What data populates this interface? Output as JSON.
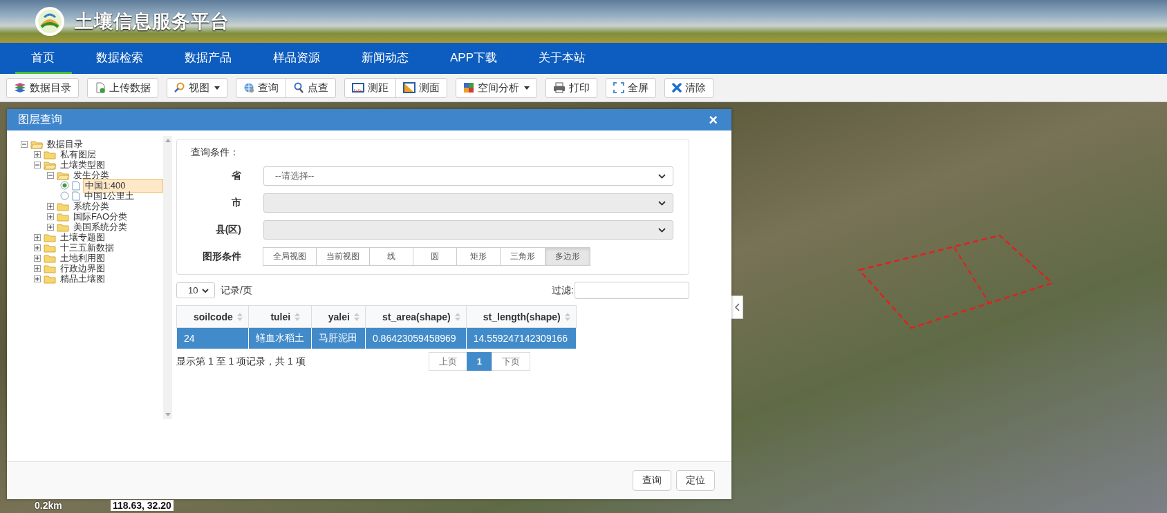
{
  "header": {
    "title": "土壤信息服务平台"
  },
  "nav": [
    {
      "label": "首页",
      "selected": true
    },
    {
      "label": "数据检索",
      "selected": false
    },
    {
      "label": "数据产品",
      "selected": false
    },
    {
      "label": "样品资源",
      "selected": false
    },
    {
      "label": "新闻动态",
      "selected": false
    },
    {
      "label": "APP下载",
      "selected": false
    },
    {
      "label": "关于本站",
      "selected": false
    }
  ],
  "toolbar": [
    {
      "buttons": [
        {
          "label": "数据目录",
          "kind": "layers",
          "dropdown": false
        }
      ]
    },
    {
      "buttons": [
        {
          "label": "上传数据",
          "kind": "upload",
          "dropdown": false
        }
      ]
    },
    {
      "buttons": [
        {
          "label": "视图",
          "kind": "search",
          "dropdown": true
        }
      ]
    },
    {
      "buttons": [
        {
          "label": "查询",
          "kind": "globe",
          "dropdown": false
        },
        {
          "label": "点查",
          "kind": "pointer",
          "dropdown": false
        }
      ]
    },
    {
      "buttons": [
        {
          "label": "测距",
          "kind": "ruler",
          "dropdown": false
        },
        {
          "label": "测面",
          "kind": "area",
          "dropdown": false
        }
      ]
    },
    {
      "buttons": [
        {
          "label": "空间分析",
          "kind": "grid",
          "dropdown": true
        }
      ]
    },
    {
      "buttons": [
        {
          "label": "打印",
          "kind": "print",
          "dropdown": false
        }
      ]
    },
    {
      "buttons": [
        {
          "label": "全屏",
          "kind": "fullscreen",
          "dropdown": false
        }
      ]
    },
    {
      "buttons": [
        {
          "label": "清除",
          "kind": "clear",
          "dropdown": false
        }
      ]
    }
  ],
  "dialog": {
    "title": "图层查询",
    "close": "×",
    "tree": [
      {
        "label": "数据目录",
        "kind": "folder",
        "expanded": true,
        "children": [
          {
            "label": "私有图层",
            "kind": "folder",
            "expanded": false
          },
          {
            "label": "土壤类型图",
            "kind": "folder",
            "expanded": true,
            "children": [
              {
                "label": "发生分类",
                "kind": "folder",
                "expanded": true,
                "children": [
                  {
                    "label": "中国1:400",
                    "kind": "layer",
                    "selected": true
                  },
                  {
                    "label": "中国1公里土",
                    "kind": "layer",
                    "selected": false
                  }
                ]
              },
              {
                "label": "系统分类",
                "kind": "folder",
                "expanded": false
              },
              {
                "label": "国际FAO分类",
                "kind": "folder",
                "expanded": false
              },
              {
                "label": "美国系统分类",
                "kind": "folder",
                "expanded": false
              }
            ]
          },
          {
            "label": "土壤专题图",
            "kind": "folder",
            "expanded": false
          },
          {
            "label": "十三五新数据",
            "kind": "folder",
            "expanded": false
          },
          {
            "label": "土地利用图",
            "kind": "folder",
            "expanded": false
          },
          {
            "label": "行政边界图",
            "kind": "folder",
            "expanded": false
          },
          {
            "label": "精品土壤图",
            "kind": "folder",
            "expanded": false
          }
        ]
      }
    ],
    "form": {
      "heading": "查询条件：",
      "fields": [
        {
          "label": "省",
          "placeholder": "--请选择--",
          "disabled": false
        },
        {
          "label": "市",
          "disabled": true
        },
        {
          "label": "县(区)",
          "disabled": true
        }
      ],
      "shape_label": "图形条件",
      "shapes": [
        {
          "label": "全局视图",
          "selected": false
        },
        {
          "label": "当前视图",
          "selected": false
        },
        {
          "label": "线",
          "selected": false
        },
        {
          "label": "圆",
          "selected": false
        },
        {
          "label": "矩形",
          "selected": false
        },
        {
          "label": "三角形",
          "selected": false
        },
        {
          "label": "多边形",
          "selected": true
        }
      ]
    },
    "page_size": "10",
    "page_size_label": "记录/页",
    "filter_label": "过滤:",
    "table": {
      "columns": [
        "soilcode",
        "tulei",
        "yalei",
        "st_area(shape)",
        "st_length(shape)"
      ],
      "rows": [
        {
          "cells": [
            "24",
            "鳝血水稻土",
            "马肝泥田",
            "0.86423059458969",
            "14.559247142309166"
          ],
          "selected": true
        }
      ]
    },
    "info": "显示第 1 至 1 项记录，共 1 项",
    "pagination": {
      "prev": "上页",
      "pages": [
        {
          "label": "1",
          "selected": true
        }
      ],
      "next": "下页"
    },
    "footer_buttons": [
      "查询",
      "定位"
    ]
  },
  "map": {
    "scale": "0.2km",
    "coordinates": "118.63, 32.20"
  }
}
